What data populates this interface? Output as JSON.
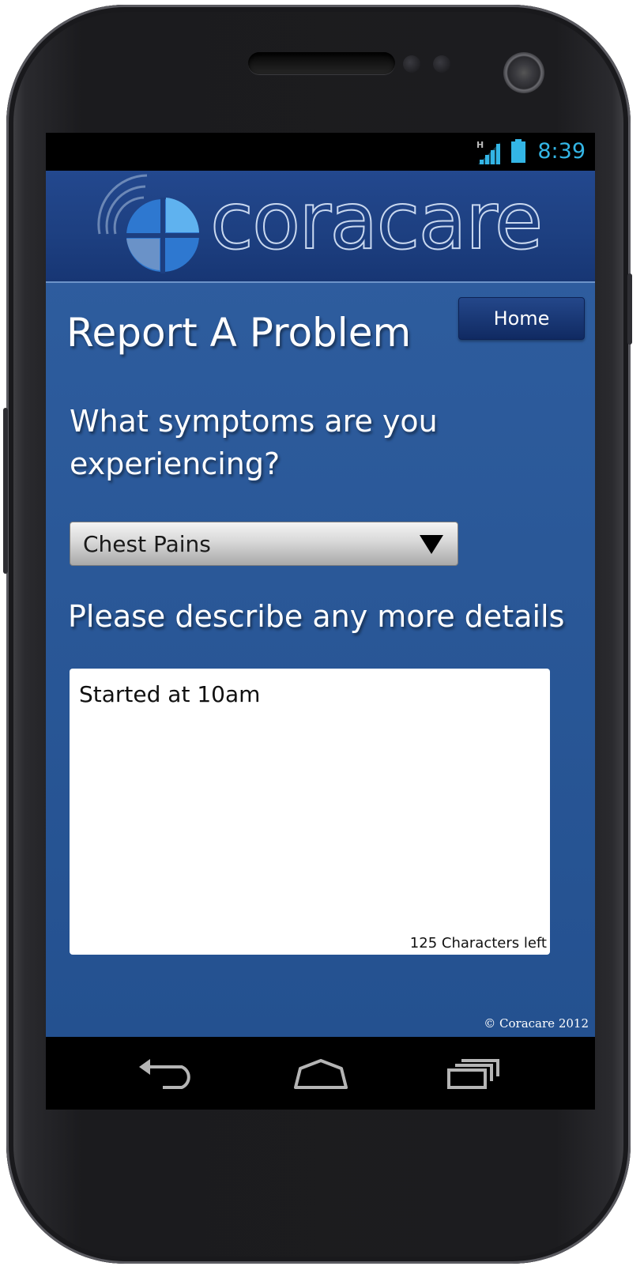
{
  "status_bar": {
    "network_indicator": "H",
    "time": "8:39",
    "icons": [
      "signal-icon",
      "battery-icon"
    ],
    "accent_color": "#33b5e5"
  },
  "header": {
    "brand_name": "coracare",
    "logo_icon": "coracare-logo-icon"
  },
  "toolbar": {
    "home_label": "Home"
  },
  "page": {
    "title": "Report A Problem",
    "symptom_question": "What symptoms are you experiencing?",
    "symptom_select": {
      "selected": "Chest Pains",
      "icon": "dropdown-triangle-icon"
    },
    "details_label": "Please describe any more details",
    "details_input": {
      "value": "Started at 10am",
      "char_counter": "125 Characters left"
    },
    "footer": "© Coracare 2012"
  },
  "nav_bar": {
    "icons": [
      "back-icon",
      "home-icon",
      "recent-apps-icon"
    ]
  },
  "colors": {
    "header_bg": "#1d3f80",
    "body_bg": "#2a5898",
    "button_bg": "#14326e"
  }
}
